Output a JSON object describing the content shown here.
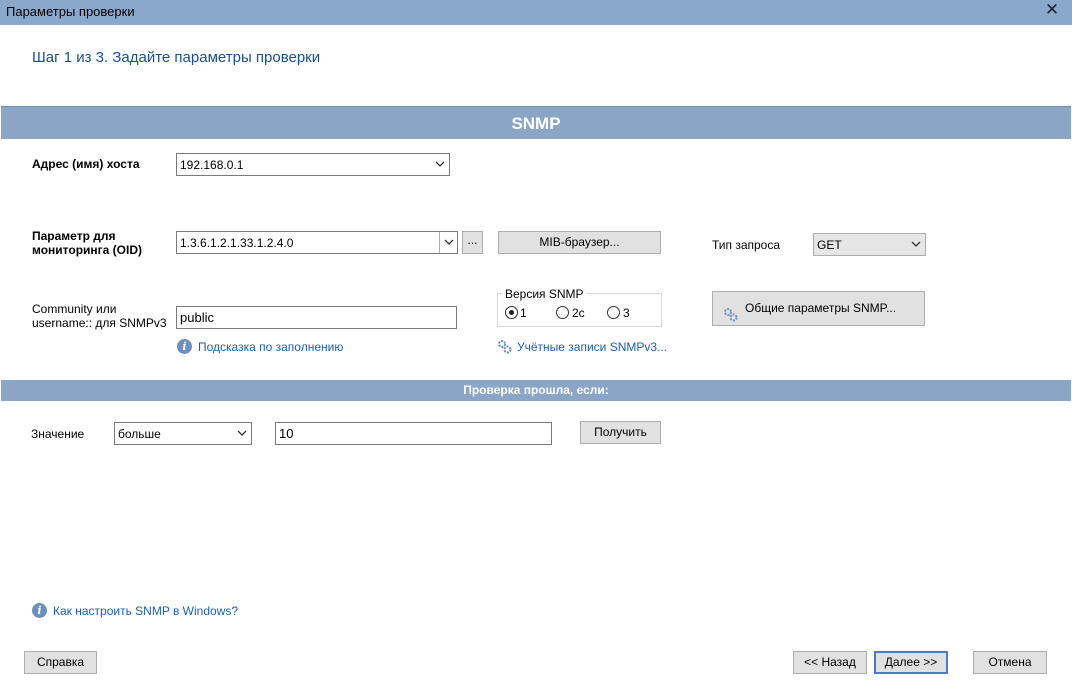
{
  "window": {
    "title": "Параметры проверки",
    "close_glyph": "✕"
  },
  "header": {
    "step_title": "Шаг 1 из 3. Задайте параметры проверки"
  },
  "snmp_section": {
    "title": "SNMP",
    "host": {
      "label": "Адрес (имя) хоста",
      "value": "192.168.0.1"
    },
    "oid": {
      "label_line1": "Параметр для",
      "label_line2": "мониторинга (OID)",
      "value": "1.3.6.1.2.1.33.1.2.4.0",
      "browse_label": "...",
      "mib_button": "MIB-браузер..."
    },
    "request_type": {
      "label": "Тип запроса",
      "value": "GET"
    },
    "community": {
      "label_line1": "Community или",
      "label_line2": "username:: для SNMPv3",
      "value": "public",
      "hint_link": "Подсказка по заполнению"
    },
    "snmp_version": {
      "legend": "Версия SNMP",
      "options": [
        {
          "label": "1",
          "selected": true
        },
        {
          "label": "2c",
          "selected": false
        },
        {
          "label": "3",
          "selected": false
        }
      ]
    },
    "snmpv3_accounts_link": "Учётные записи SNMPv3...",
    "general_params_button": "Общие параметры SNMP..."
  },
  "check_section": {
    "title": "Проверка прошла, если:",
    "value_label": "Значение",
    "comparison": "больше",
    "threshold": "10",
    "get_button": "Получить"
  },
  "footer": {
    "help_link": "Как настроить SNMP в Windows?",
    "help_button": "Справка",
    "back_button": "<< Назад",
    "next_button": "Далее >>",
    "cancel_button": "Отмена"
  },
  "colors": {
    "titlebar": "#8aa7cc",
    "section_bar": "#8aa5c6",
    "header_text": "#1a4e96",
    "link": "#1c5fb0"
  }
}
